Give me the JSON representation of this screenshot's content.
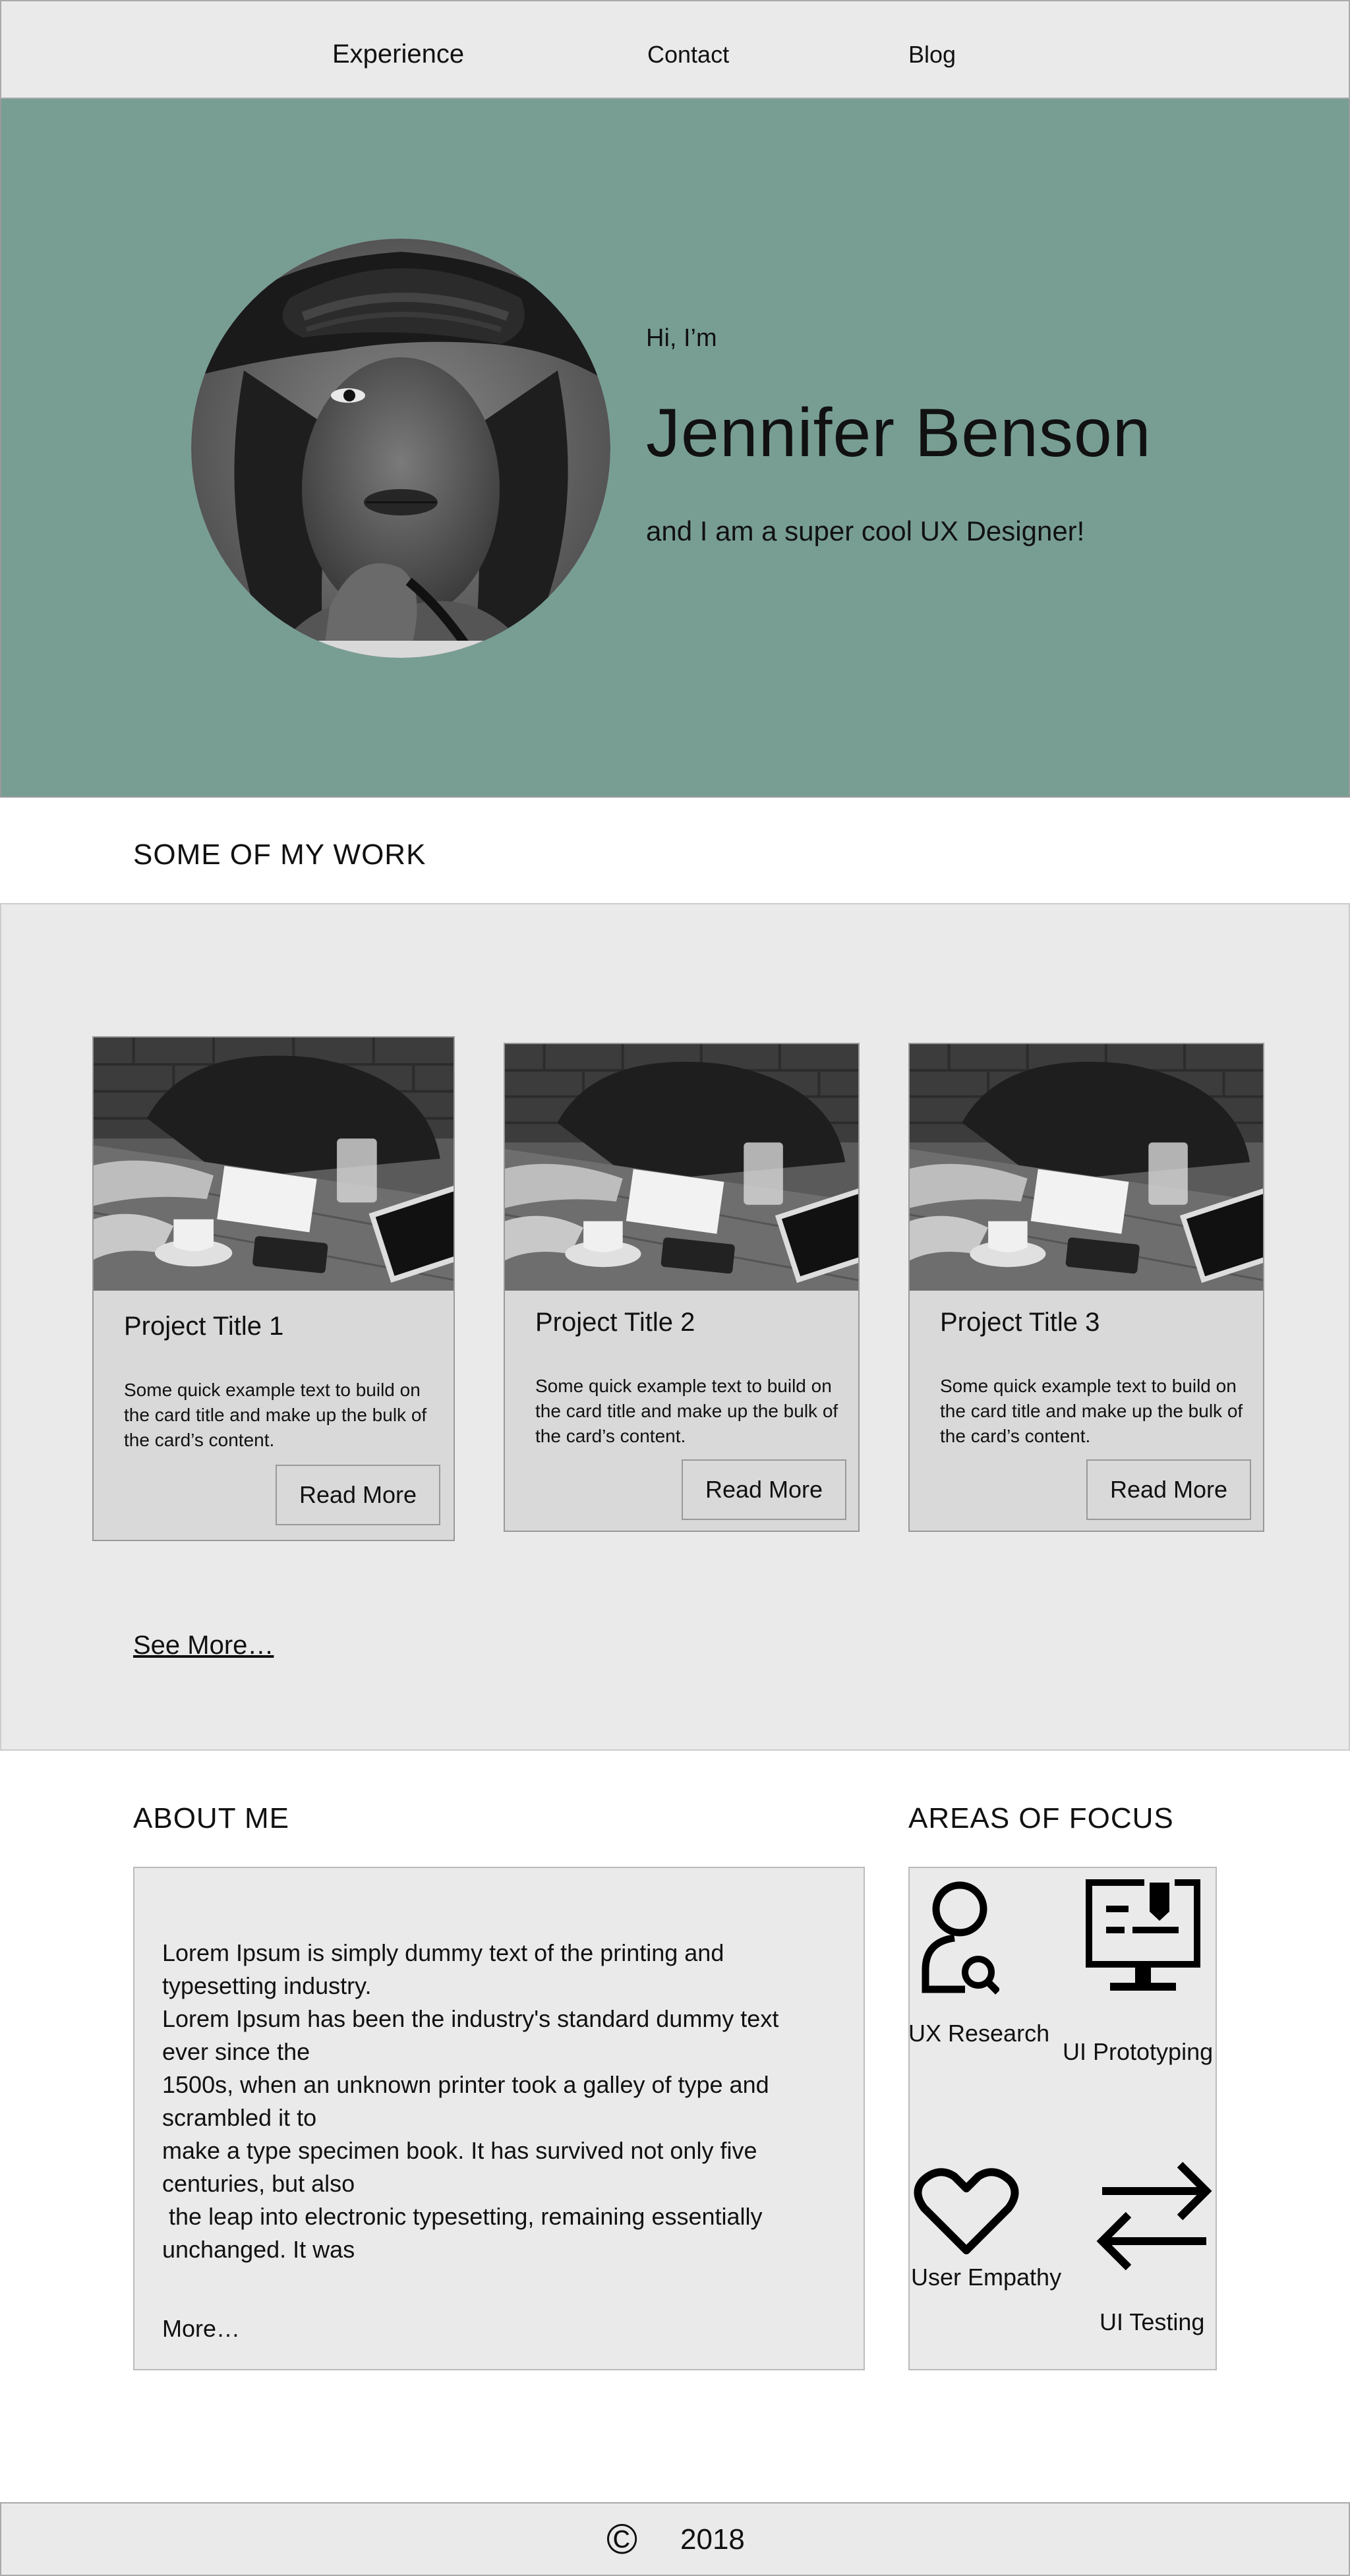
{
  "nav": {
    "items": [
      {
        "label": "Experience"
      },
      {
        "label": "Contact"
      },
      {
        "label": "Blog"
      }
    ]
  },
  "hero": {
    "greeting": "Hi, I’m",
    "name": "Jennifer Benson",
    "tagline": "and I am a super cool UX Designer!",
    "bg_color": "#789e94"
  },
  "work": {
    "title": "SOME OF MY WORK",
    "cards": [
      {
        "title": "Project Title 1",
        "text": "Some quick example text to build on the card title and make up the bulk of the card’s content.",
        "button": "Read More"
      },
      {
        "title": "Project Title 2",
        "text": "Some quick example text to build on the card title and make up the bulk of the card’s content.",
        "button": "Read More"
      },
      {
        "title": "Project Title 3",
        "text": "Some quick example text to build on the card title and make up the bulk of the card’s content.",
        "button": "Read More"
      }
    ],
    "see_more": "See More…"
  },
  "about": {
    "title": "ABOUT ME",
    "paragraphs": [
      "Lorem Ipsum is simply dummy text of the printing and typesetting industry.",
      "Lorem Ipsum has been the industry's standard dummy text ever since the",
      "1500s, when an unknown printer took a galley of type and scrambled it to",
      "make a type specimen book. It has survived not only five centuries, but also",
      " the leap into electronic typesetting, remaining essentially unchanged. It was"
    ],
    "more": "More…"
  },
  "focus": {
    "title": "AREAS OF FOCUS",
    "items": [
      {
        "label": "UX Research",
        "icon": "user-search-icon"
      },
      {
        "label": "UI Prototyping",
        "icon": "monitor-design-icon"
      },
      {
        "label": "User Empathy",
        "icon": "heart-icon"
      },
      {
        "label": "UI Testing",
        "icon": "swap-arrows-icon"
      }
    ]
  },
  "footer": {
    "copyright_symbol": "©",
    "year": "2018"
  }
}
